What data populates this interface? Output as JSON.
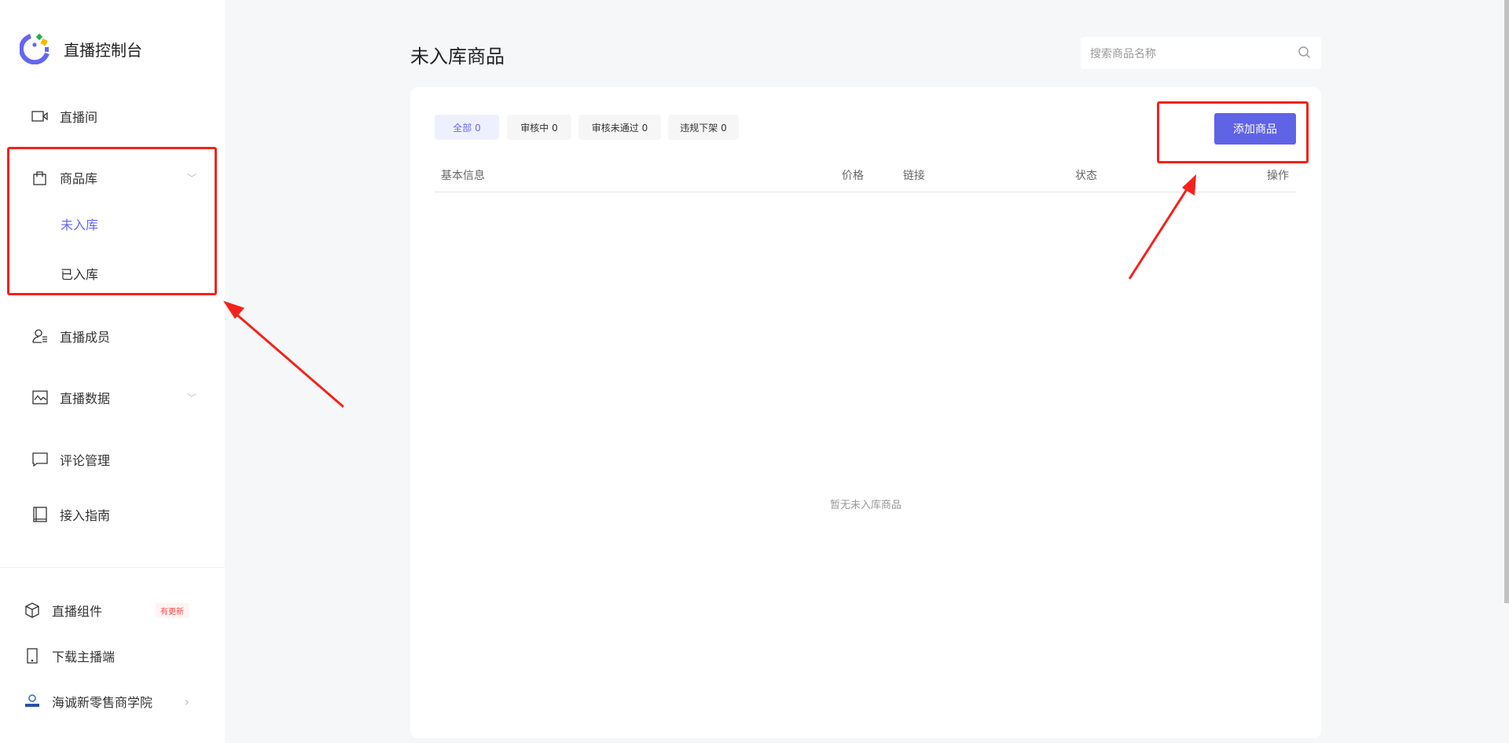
{
  "app": {
    "title": "直播控制台"
  },
  "sidebar": {
    "items": [
      {
        "label": "直播间",
        "icon": "video-camera-icon"
      },
      {
        "label": "商品库",
        "icon": "shopping-bag-icon",
        "sub": [
          "未入库",
          "已入库"
        ]
      },
      {
        "label": "直播成员",
        "icon": "member-icon"
      },
      {
        "label": "直播数据",
        "icon": "chart-icon"
      },
      {
        "label": "评论管理",
        "icon": "comment-icon"
      },
      {
        "label": "接入指南",
        "icon": "book-icon"
      }
    ],
    "bottom": [
      {
        "label": "直播组件",
        "icon": "cube-icon",
        "badge": "有更新"
      },
      {
        "label": "下载主播端",
        "icon": "phone-icon"
      },
      {
        "label": "海诚新零售商学院",
        "icon": "academy-logo-icon"
      }
    ]
  },
  "main": {
    "title": "未入库商品",
    "search_placeholder": "搜索商品名称",
    "tabs": [
      "全部 0",
      "审核中 0",
      "审核未通过 0",
      "违规下架 0"
    ],
    "add_button": "添加商品",
    "columns": [
      "基本信息",
      "价格",
      "链接",
      "状态",
      "操作"
    ],
    "empty": "暂无未入库商品"
  },
  "colors": {
    "accent": "#5f63e5",
    "annotation": "#f5211b"
  }
}
